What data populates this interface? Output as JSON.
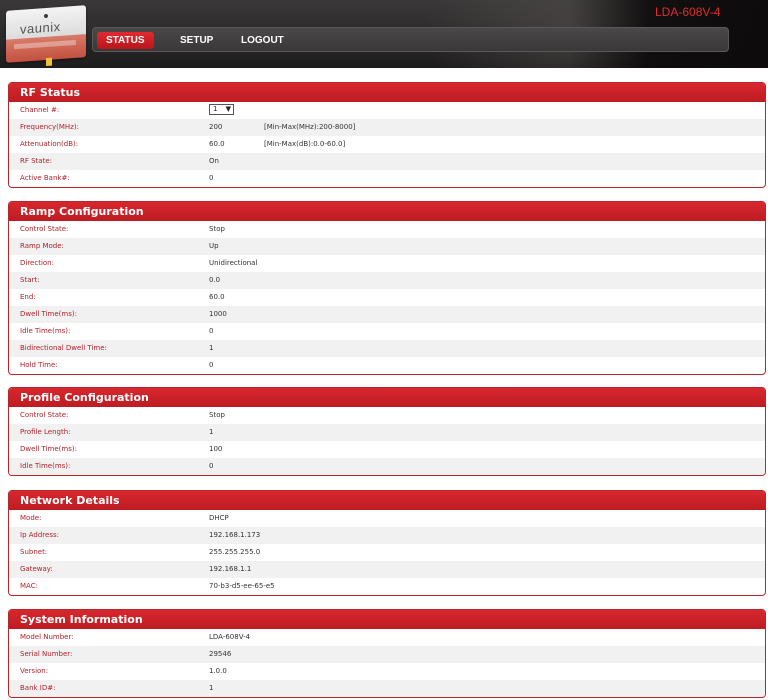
{
  "header": {
    "logo_text": "vaunix",
    "device_name": "LDA-608V-4",
    "nav": [
      {
        "label": "STATUS",
        "active": true
      },
      {
        "label": "SETUP",
        "active": false
      },
      {
        "label": "LOGOUT",
        "active": false
      }
    ]
  },
  "rf_status": {
    "title": "RF Status",
    "channel_label": "Channel #:",
    "channel_value": "1",
    "rows": [
      {
        "label": "Frequency(MHz):",
        "value": "200",
        "hint": "[Min-Max(MHz):200-8000]"
      },
      {
        "label": "Attenuation(dB):",
        "value": "60.0",
        "hint": "[Min-Max(dB):0.0-60.0]"
      },
      {
        "label": "RF State:",
        "value": "On",
        "hint": ""
      },
      {
        "label": "Active Bank#:",
        "value": "0",
        "hint": ""
      }
    ]
  },
  "ramp": {
    "title": "Ramp Configuration",
    "rows": [
      {
        "label": "Control State:",
        "value": "Stop"
      },
      {
        "label": "Ramp Mode:",
        "value": "Up"
      },
      {
        "label": "Direction:",
        "value": "Unidirectional"
      },
      {
        "label": "Start:",
        "value": "0.0"
      },
      {
        "label": "End:",
        "value": "60.0"
      },
      {
        "label": "Dwell Time(ms):",
        "value": "1000"
      },
      {
        "label": "Idle Time(ms):",
        "value": "0"
      },
      {
        "label": "Bidirectional Dwell Time:",
        "value": "1"
      },
      {
        "label": "Hold Time:",
        "value": "0"
      }
    ]
  },
  "profile": {
    "title": "Profile Configuration",
    "rows": [
      {
        "label": "Control State:",
        "value": "Stop"
      },
      {
        "label": "Profile Length:",
        "value": "1"
      },
      {
        "label": "Dwell Time(ms):",
        "value": "100"
      },
      {
        "label": "Idle Time(ms):",
        "value": "0"
      }
    ]
  },
  "network": {
    "title": "Network Details",
    "rows": [
      {
        "label": "Mode:",
        "value": "DHCP"
      },
      {
        "label": "Ip Address:",
        "value": "192.168.1.173"
      },
      {
        "label": "Subnet:",
        "value": "255.255.255.0"
      },
      {
        "label": "Gateway:",
        "value": "192.168.1.1"
      },
      {
        "label": "MAC:",
        "value": "70-b3-d5-ee-65-e5"
      }
    ]
  },
  "system": {
    "title": "System Information",
    "rows": [
      {
        "label": "Model Number:",
        "value": "LDA-608V-4"
      },
      {
        "label": "Serial Number:",
        "value": "29546"
      },
      {
        "label": "Version:",
        "value": "1.0.0"
      },
      {
        "label": "Bank ID#:",
        "value": "1"
      }
    ]
  }
}
